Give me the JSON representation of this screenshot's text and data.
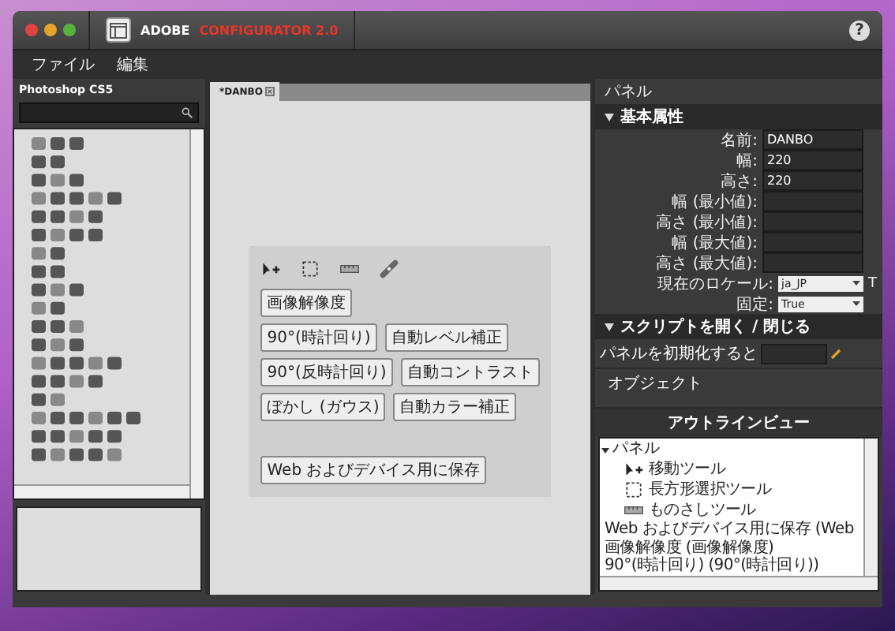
{
  "window": {
    "brand": "ADOBE",
    "product": "CONFIGURATOR 2.0",
    "help": "?"
  },
  "menu": [
    "ファイル",
    "編集"
  ],
  "palette": {
    "title": "Photoshop CS5"
  },
  "document_tab": {
    "label": "*DANBO",
    "selected": true
  },
  "preview": {
    "tools": [
      {
        "kind": "move"
      },
      {
        "kind": "marquee"
      },
      {
        "kind": "ruler"
      },
      {
        "kind": "bandage"
      }
    ],
    "button_rows": [
      [
        "画像解像度"
      ],
      [
        "90°(時計回り)",
        "自動レベル補正"
      ],
      [
        "90°(反時計回り)",
        "自動コントラスト"
      ],
      [
        "ぼかし (ガウス)",
        "自動カラー補正"
      ]
    ],
    "save_button": "Web およびデバイス用に保存"
  },
  "properties": {
    "title": "パネル",
    "section": "基本属性",
    "rows": [
      {
        "label": "名前:",
        "kind": "text",
        "value": "DANBO"
      },
      {
        "label": "幅:",
        "kind": "text",
        "value": "220"
      },
      {
        "label": "高さ:",
        "kind": "text",
        "value": "220"
      },
      {
        "label": "幅 (最小値):",
        "kind": "text"
      },
      {
        "label": "高さ (最小値):",
        "kind": "text"
      },
      {
        "label": "幅 (最大値):",
        "kind": "text"
      },
      {
        "label": "高さ (最大値):",
        "kind": "text"
      },
      {
        "label": "現在のロケール:",
        "kind": "select",
        "value": "ja_JP",
        "extra": "T"
      },
      {
        "label": "固定:",
        "kind": "select",
        "value": "True"
      }
    ],
    "script_section": "スクリプトを開く / 閉じる",
    "script_label": "パネルを初期化すると",
    "objects": "オブジェクト"
  },
  "outline": {
    "title": "アウトラインビュー",
    "tree": [
      {
        "label": "パネル",
        "expanded": true,
        "children": [
          {
            "label": "移動ツール",
            "kind": "move"
          },
          {
            "label": "長方形選択ツール",
            "kind": "marquee"
          },
          {
            "label": "ものさしツール",
            "kind": "ruler"
          },
          {
            "label": "Web およびデバイス用に保存 (Web"
          },
          {
            "label": "画像解像度 (画像解像度)"
          },
          {
            "label": "90°(時計回り) (90°(時計回り))"
          }
        ]
      }
    ]
  }
}
